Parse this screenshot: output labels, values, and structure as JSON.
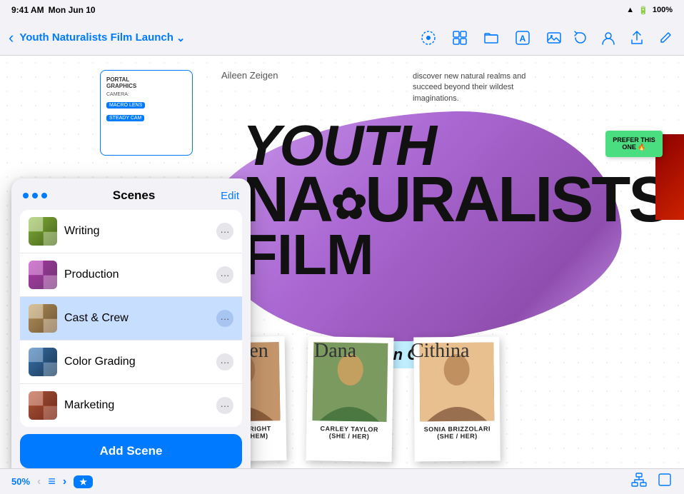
{
  "statusBar": {
    "time": "9:41 AM",
    "date": "Mon Jun 10",
    "wifi": "WiFi",
    "battery": "100%"
  },
  "toolbar": {
    "backLabel": "‹",
    "projectTitle": "Youth Naturalists Film Launch",
    "dropdownIcon": "⌄",
    "icons": {
      "lasso": "⬡",
      "grid": "⊞",
      "folder": "⬒",
      "text": "A",
      "image": "⬚",
      "undo": "↩",
      "people": "⊙",
      "share": "↑",
      "edit": "✏"
    }
  },
  "canvas": {
    "descriptionText": "discover new natural realms and succeed beyond their wildest imaginations.",
    "nameLabel": "Aileen Zeigen",
    "filmTitle": {
      "youth": "YOUTH",
      "naturalists": "NA✿URALISTS",
      "film": "FILM"
    },
    "stickyNote": {
      "text": "PREFER THIS ONE 🔥"
    },
    "mainCastLabel": "Main CAST",
    "castMembers": [
      {
        "signature": "Jayden",
        "name": "TY FULLBRIGHT",
        "pronouns": "(THEY / THEM)"
      },
      {
        "signature": "Dana",
        "name": "CARLEY TAYLOR",
        "pronouns": "(SHE / HER)"
      },
      {
        "signature": "Cithina",
        "name": "SONIA BRIZZOLARI",
        "pronouns": "(SHE / HER)"
      }
    ]
  },
  "scenesPanel": {
    "dotsCount": 3,
    "title": "Scenes",
    "editLabel": "Edit",
    "scenes": [
      {
        "id": 1,
        "name": "Writing",
        "active": false,
        "thumbClass": "scene-thumb-1"
      },
      {
        "id": 2,
        "name": "Production",
        "active": false,
        "thumbClass": "scene-thumb-2"
      },
      {
        "id": 3,
        "name": "Cast & Crew",
        "active": true,
        "thumbClass": "scene-thumb-3"
      },
      {
        "id": 4,
        "name": "Color Grading",
        "active": false,
        "thumbClass": "scene-thumb-4"
      },
      {
        "id": 5,
        "name": "Marketing",
        "active": false,
        "thumbClass": "scene-thumb-5"
      }
    ],
    "addSceneLabel": "Add Scene"
  },
  "bottomBar": {
    "zoomLevel": "50%",
    "prevIcon": "‹",
    "listIcon": "≡",
    "nextIcon": "›",
    "starIcon": "★",
    "hierarchyIcon": "⊤",
    "squareIcon": "▢"
  }
}
